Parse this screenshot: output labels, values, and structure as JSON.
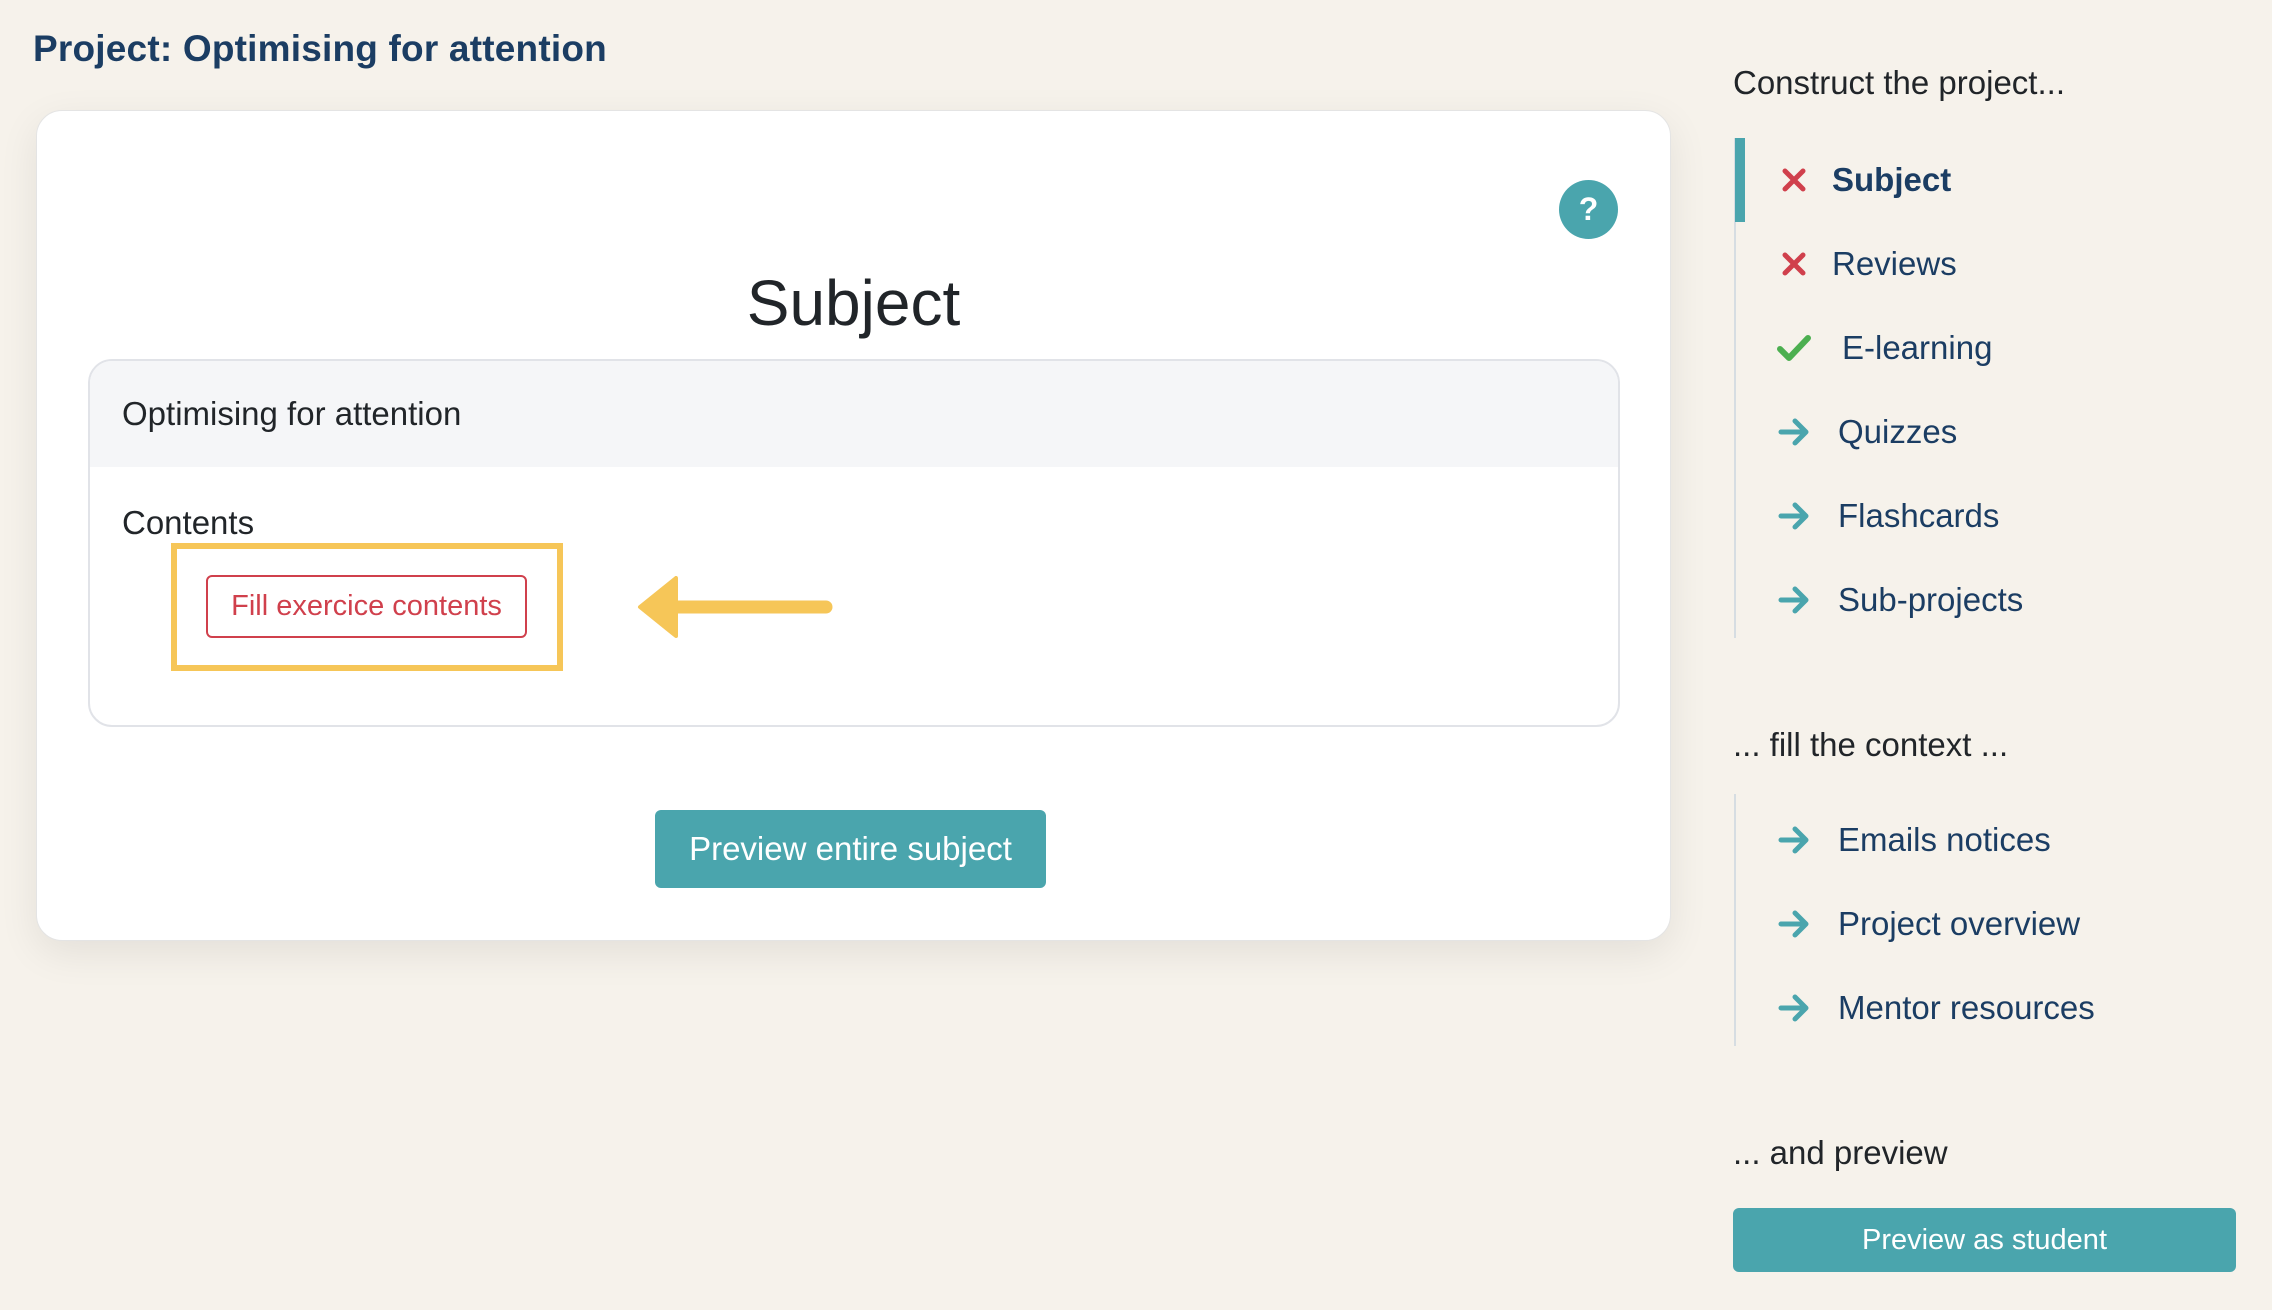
{
  "page": {
    "title": "Project: Optimising for attention"
  },
  "card": {
    "title": "Subject",
    "help_label": "?",
    "subject_name": "Optimising for attention",
    "contents_label": "Contents",
    "fill_button": "Fill exercice contents",
    "preview_button": "Preview entire subject"
  },
  "annotation": {
    "highlight_color": "#f6c658",
    "arrow_color": "#f6c658"
  },
  "sidebar": {
    "construct_heading": "Construct the project...",
    "construct_items": [
      {
        "label": "Subject",
        "status": "incomplete",
        "icon": "x-icon",
        "active": true
      },
      {
        "label": "Reviews",
        "status": "incomplete",
        "icon": "x-icon",
        "active": false
      },
      {
        "label": "E-learning",
        "status": "complete",
        "icon": "check-icon",
        "active": false
      },
      {
        "label": "Quizzes",
        "status": "todo",
        "icon": "arrow-right-icon",
        "active": false
      },
      {
        "label": "Flashcards",
        "status": "todo",
        "icon": "arrow-right-icon",
        "active": false
      },
      {
        "label": "Sub-projects",
        "status": "todo",
        "icon": "arrow-right-icon",
        "active": false
      }
    ],
    "context_heading": "... fill the context ...",
    "context_items": [
      {
        "label": "Emails notices",
        "icon": "arrow-right-icon"
      },
      {
        "label": "Project overview",
        "icon": "arrow-right-icon"
      },
      {
        "label": "Mentor resources",
        "icon": "arrow-right-icon"
      }
    ],
    "preview_heading": "... and preview",
    "preview_button": "Preview as student"
  },
  "colors": {
    "accent": "#4aa5ad",
    "title": "#1b3d63",
    "danger": "#d0404c",
    "success": "#4caf50"
  }
}
